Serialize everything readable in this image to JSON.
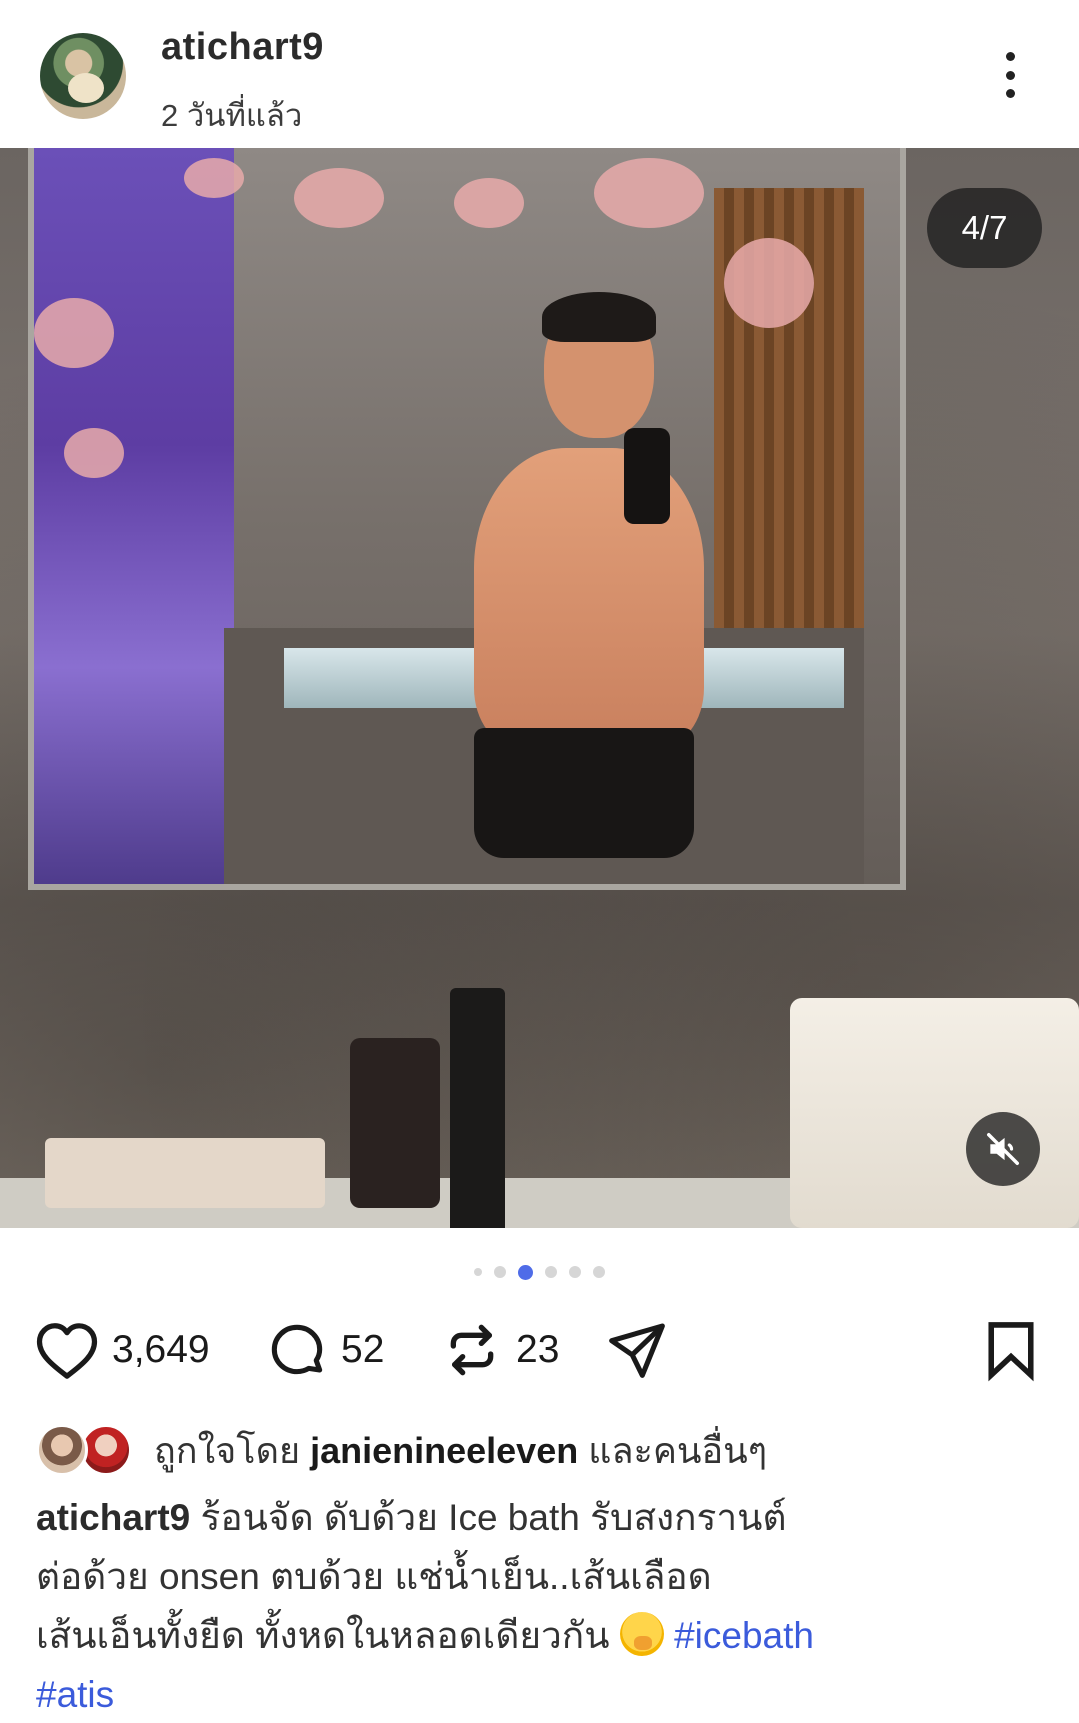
{
  "post": {
    "username": "atichart9",
    "timestamp": "2 วันที่แล้ว",
    "media_counter": "4/7",
    "carousel": {
      "total": 7,
      "current": 4
    }
  },
  "actions": {
    "likes": "3,649",
    "comments": "52",
    "reposts": "23"
  },
  "liked_by": {
    "prefix": "ถูกใจโดย",
    "user": "janienineeleven",
    "suffix": "และคนอื่นๆ"
  },
  "caption": {
    "username": "atichart9",
    "line1": "ร้อนจัด ดับด้วย Ice bath รับสงกรานต์",
    "line2": "ต่อด้วย onsen ตบด้วย แช่น้ำเย็น..เส้นเลือด",
    "line3": "เส้นเอ็นทั้งยืด ทั้งหดในหลอดเดียวกัน",
    "hashtags": [
      "#icebath",
      "#atis"
    ]
  },
  "icons": {
    "more": "more-vertical-icon",
    "mute": "speaker-muted-icon",
    "like": "heart-icon",
    "comment": "comment-bubble-icon",
    "repost": "repost-icon",
    "share": "paper-plane-icon",
    "bookmark": "bookmark-icon"
  },
  "colors": {
    "hashtag": "#3b5bdb",
    "active_dot": "#4f6ce8"
  }
}
